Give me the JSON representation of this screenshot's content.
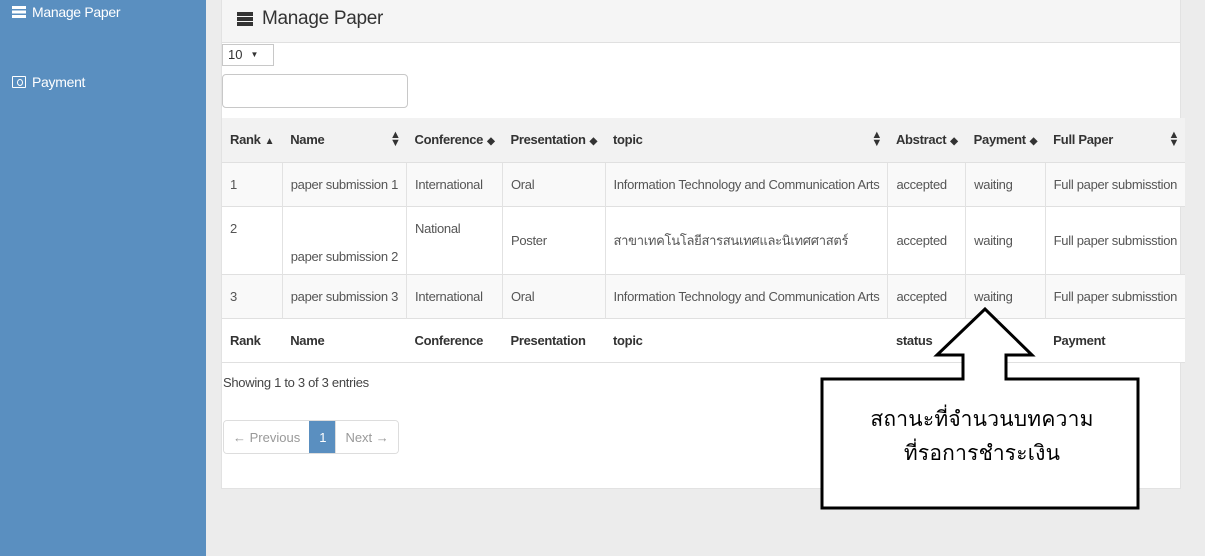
{
  "sidebar": {
    "items": [
      {
        "label": "Manage Paper",
        "icon": "server-icon"
      },
      {
        "label": "Payment",
        "icon": "money-icon"
      }
    ],
    "background": "#5a8fc0"
  },
  "panel": {
    "title": "Manage Paper",
    "length_select": "10",
    "search_value": ""
  },
  "table": {
    "headers": [
      "Rank",
      "Name",
      "Conference",
      "Presentation",
      "topic",
      "Abstract",
      "Payment",
      "Full Paper"
    ],
    "rows": [
      [
        "1",
        "paper submission 1",
        "International",
        "Oral",
        "Information Technology and Communication Arts",
        "accepted",
        "waiting",
        "Full paper submisstion"
      ],
      [
        "2",
        "paper submission 2",
        "National",
        "Poster",
        "สาขาเทคโนโลยีสารสนเทศและนิเทศศาสตร์",
        "accepted",
        "waiting",
        "Full paper submisstion"
      ],
      [
        "3",
        "paper submission 3",
        "International",
        "Oral",
        "Information Technology and Communication Arts",
        "accepted",
        "waiting",
        "Full paper submisstion"
      ]
    ],
    "footer": [
      "Rank",
      "Name",
      "Conference",
      "Presentation",
      "topic",
      "status",
      "",
      "Payment"
    ]
  },
  "info_text": "Showing 1 to 3 of 3 entries",
  "pagination": {
    "previous": "← Previous",
    "current": "1",
    "next": "Next →"
  },
  "callout": {
    "line1": "สถานะที่จำนวนบทความ",
    "line2": "ที่รอการชำระเงิน"
  },
  "colors": {
    "accent": "#5a8fc0",
    "page_bg": "#ececec"
  }
}
